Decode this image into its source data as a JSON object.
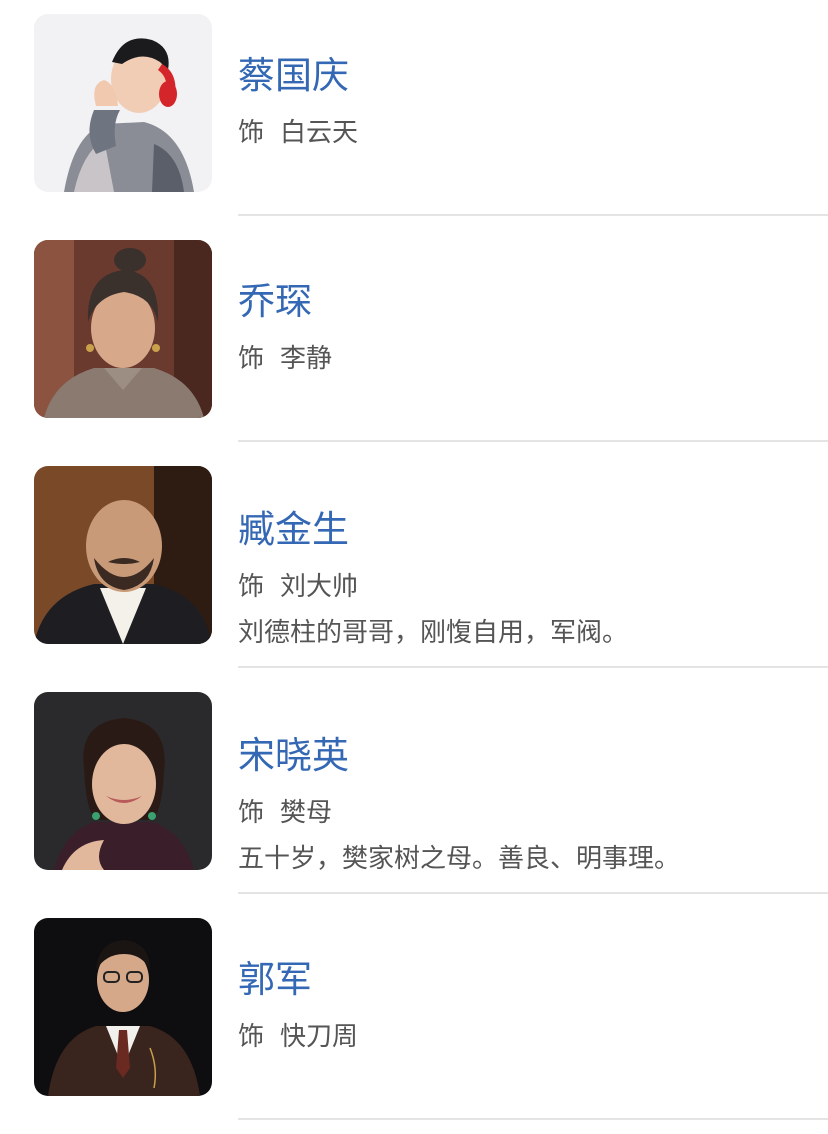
{
  "cast": [
    {
      "actor": "蔡国庆",
      "role_prefix": "饰",
      "role": "白云天",
      "description": ""
    },
    {
      "actor": "乔琛",
      "role_prefix": "饰",
      "role": "李静",
      "description": ""
    },
    {
      "actor": "臧金生",
      "role_prefix": "饰",
      "role": "刘大帅",
      "description": "刘德柱的哥哥，刚愎自用，军阀。"
    },
    {
      "actor": "宋晓英",
      "role_prefix": "饰",
      "role": "樊母",
      "description": "五十岁，樊家树之母。善良、明事理。"
    },
    {
      "actor": "郭军",
      "role_prefix": "饰",
      "role": "快刀周",
      "description": ""
    }
  ]
}
